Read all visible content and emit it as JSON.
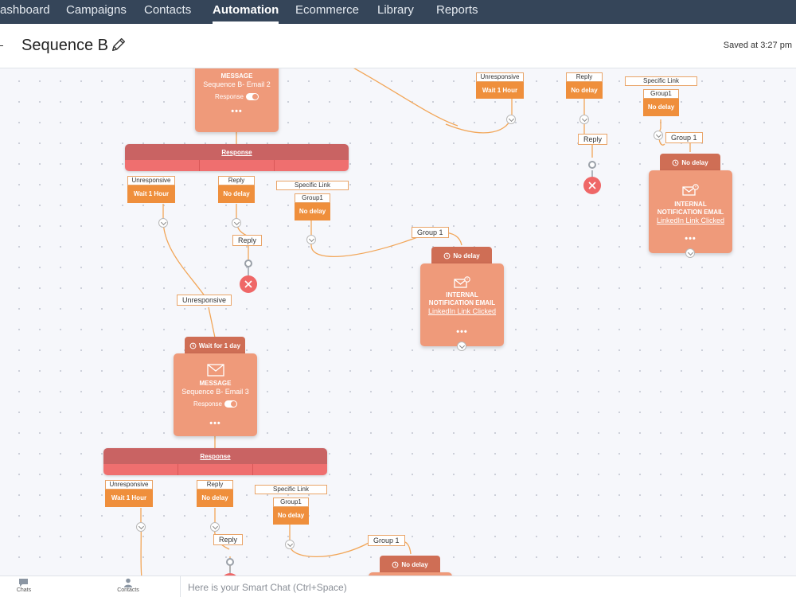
{
  "nav": {
    "items": [
      {
        "label": "ashboard",
        "active": false
      },
      {
        "label": "Campaigns",
        "active": false
      },
      {
        "label": "Contacts",
        "active": false
      },
      {
        "label": "Automation",
        "active": true
      },
      {
        "label": "Ecommerce",
        "active": false
      },
      {
        "label": "Library",
        "active": false
      },
      {
        "label": "Reports",
        "active": false
      }
    ]
  },
  "header": {
    "title": "Sequence B",
    "saved": "Saved at 3:27 pm",
    "edit_icon": "pencil-icon"
  },
  "colors": {
    "nav_bg": "#354559",
    "card": "#ef9a7a",
    "card_tab": "#cf6e55",
    "response_bar_top": "#c96363",
    "response_bar_bottom": "#ef6f6f",
    "action_button": "#ef8f3c",
    "end_node": "#ef6767",
    "wire": "#f2a658"
  },
  "canvas": {
    "email2": {
      "type": "MESSAGE",
      "name": "Sequence B- Email 2",
      "response": "Response",
      "more": "•••"
    },
    "bar1": {
      "label": "Response"
    },
    "b1_unresp": {
      "label": "Unresponsive",
      "action": "Wait 1 Hour"
    },
    "b1_reply": {
      "label": "Reply",
      "action": "No delay"
    },
    "b1_link": {
      "label": "Specific Link",
      "group": "Group1",
      "action": "No delay"
    },
    "b1_reply_pill": "Reply",
    "b1_group_pill": "Group 1",
    "b1_unresp_pill": "Unresponsive",
    "notif1": {
      "tab": "No delay",
      "type1": "INTERNAL",
      "type2": "NOTIFICATION EMAIL",
      "link": "LinkedIn Link Clicked",
      "more": "•••"
    },
    "email3": {
      "tab": "Wait for 1 day",
      "type": "MESSAGE",
      "name": "Sequence B- Email 3",
      "response": "Response",
      "more": "•••"
    },
    "bar2": {
      "label": "Response"
    },
    "b2_unresp": {
      "label": "Unresponsive",
      "action": "Wait 1 Hour"
    },
    "b2_reply": {
      "label": "Reply",
      "action": "No delay"
    },
    "b2_link": {
      "label": "Specific Link",
      "group": "Group1",
      "action": "No delay"
    },
    "b2_reply_pill": "Reply",
    "b2_group_pill": "Group 1",
    "notif3": {
      "tab": "No delay"
    },
    "top_unresp": {
      "label": "Unresponsive",
      "action": "Wait 1 Hour"
    },
    "top_reply": {
      "label": "Reply",
      "action": "No delay"
    },
    "top_link": {
      "label": "Specific Link",
      "group": "Group1",
      "action": "No delay"
    },
    "top_reply_pill": "Reply",
    "top_group_pill": "Group 1",
    "notif2": {
      "tab": "No delay",
      "type1": "INTERNAL",
      "type2": "NOTIFICATION EMAIL",
      "link": "LinkedIn Link Clicked",
      "more": "•••"
    }
  },
  "bottombar": {
    "chats": "Chats",
    "contacts": "Contacts",
    "smart_chat_placeholder": "Here is your Smart Chat (Ctrl+Space)"
  }
}
